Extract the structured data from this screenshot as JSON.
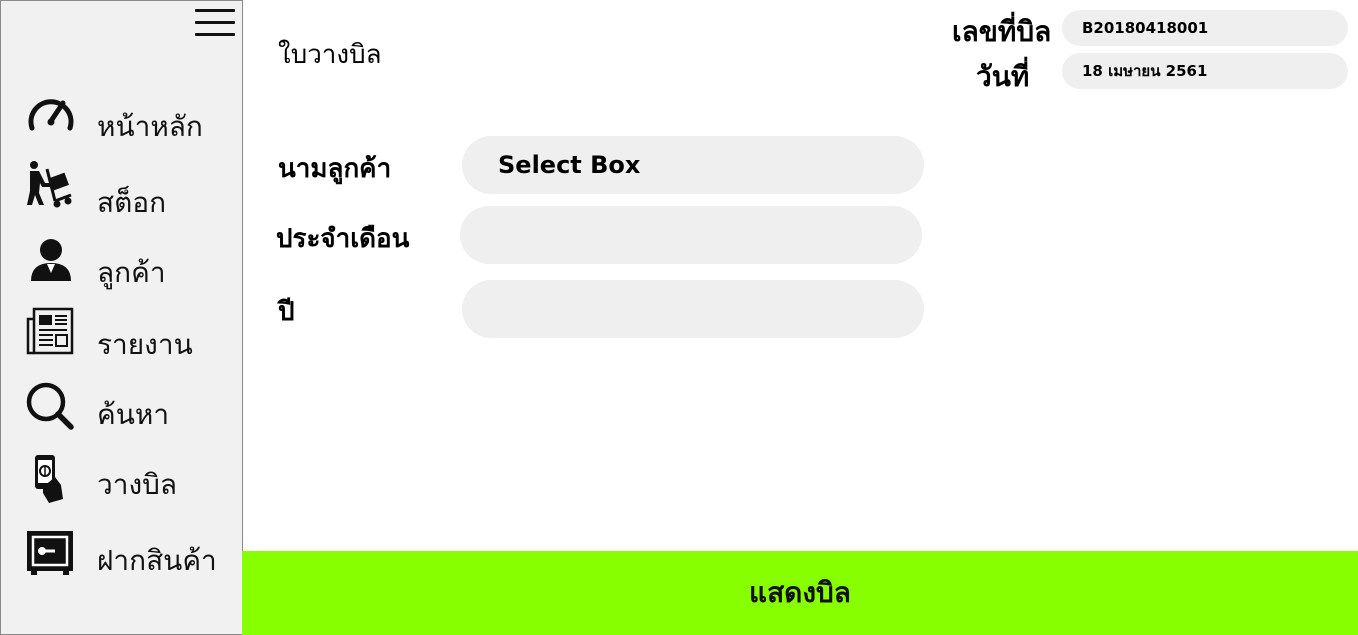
{
  "sidebar": {
    "menu_icon": "hamburger-menu-icon",
    "items": [
      {
        "label": "หน้าหลัก",
        "icon": "speedometer-icon"
      },
      {
        "label": "สต็อก",
        "icon": "hand-truck-icon"
      },
      {
        "label": "ลูกค้า",
        "icon": "customer-icon"
      },
      {
        "label": "รายงาน",
        "icon": "newspaper-icon"
      },
      {
        "label": "ค้นหา",
        "icon": "search-icon"
      },
      {
        "label": "วางบิล",
        "icon": "hand-money-icon"
      },
      {
        "label": "ฝากสินค้า",
        "icon": "safe-icon"
      }
    ]
  },
  "header": {
    "title": "ใบวางบิล",
    "bill_no_label": "เลขที่บิล",
    "bill_no_value": "B20180418001",
    "date_label": "วันที่",
    "date_value": "18 เมษายน 2561"
  },
  "form": {
    "customer_label": "นามลูกค้า",
    "customer_value": "Select Box",
    "month_label": "ประจำเดือน",
    "month_value": "",
    "year_label": "ปี",
    "year_value": ""
  },
  "actions": {
    "show_bill_label": "แสดงบิล"
  },
  "colors": {
    "accent": "#87ff00",
    "sidebar_bg": "#f1f1f1",
    "field_bg": "#efefef"
  }
}
